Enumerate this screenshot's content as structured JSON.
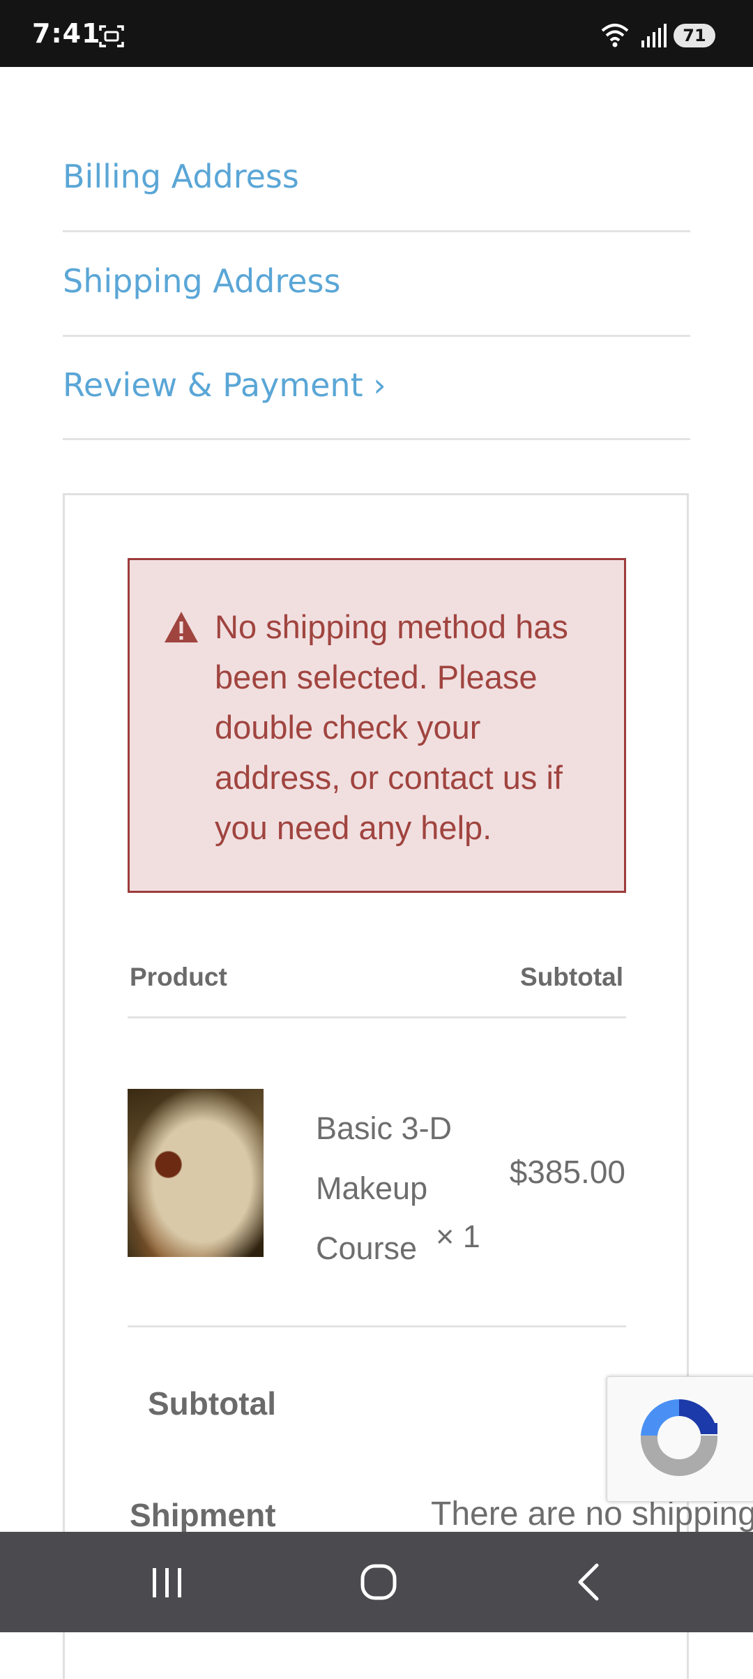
{
  "status_bar": {
    "time": "7:41",
    "battery": "71"
  },
  "steps": {
    "billing": "Billing Address",
    "shipping": "Shipping Address",
    "review": "Review & Payment ›"
  },
  "alert": {
    "message": "No shipping method has been selected. Please double check your address, or contact us if you need any help.",
    "icon": "warning-icon"
  },
  "table": {
    "col_product": "Product",
    "col_subtotal": "Subtotal",
    "rows": [
      {
        "name": "Basic 3-D Makeup Course",
        "qty": "× 1",
        "price": "$385.00"
      }
    ]
  },
  "totals": {
    "subtotal_label": "Subtotal",
    "shipment_label": "Shipment",
    "shipment_value": "There are no shipping"
  },
  "nav": {
    "icons": [
      "recents-icon",
      "home-icon",
      "back-icon"
    ]
  },
  "colors": {
    "link": "#5aa6d6",
    "alert_border": "#9d3b3b",
    "alert_bg": "#f1dfe0",
    "alert_text": "#a0443f"
  }
}
